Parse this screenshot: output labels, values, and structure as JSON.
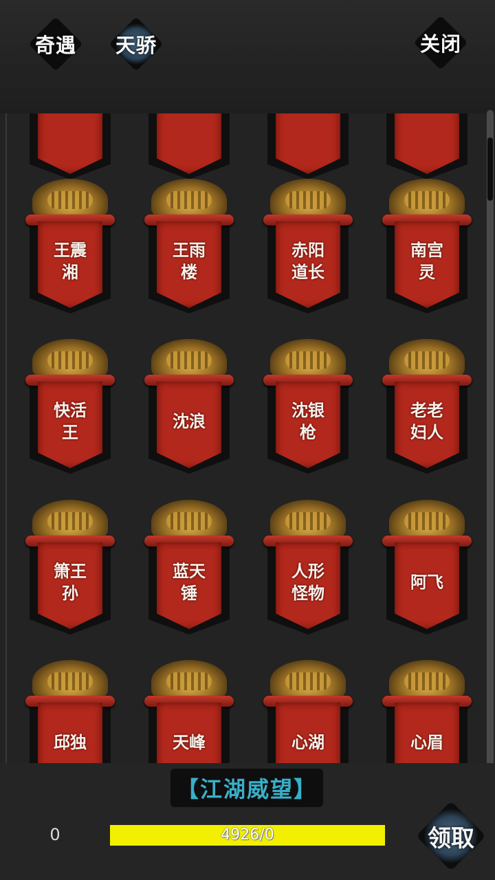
{
  "tabs": [
    {
      "label": "奇遇",
      "active": false
    },
    {
      "label": "天骄",
      "active": true
    }
  ],
  "close_label": "关闭",
  "banners": [
    {
      "name": ""
    },
    {
      "name": ""
    },
    {
      "name": ""
    },
    {
      "name": ""
    },
    {
      "name": "王震湘"
    },
    {
      "name": "王雨楼"
    },
    {
      "name": "赤阳道长"
    },
    {
      "name": "南宫灵"
    },
    {
      "name": "快活王"
    },
    {
      "name": "沈浪"
    },
    {
      "name": "沈银枪"
    },
    {
      "name": "老老妇人"
    },
    {
      "name": "箫王孙"
    },
    {
      "name": "蓝天锤"
    },
    {
      "name": "人形怪物"
    },
    {
      "name": "阿飞"
    },
    {
      "name": "邱独"
    },
    {
      "name": "天峰"
    },
    {
      "name": "心湖"
    },
    {
      "name": "心眉"
    }
  ],
  "footer": {
    "title": "【江湖威望】",
    "count": "0",
    "progress_text": "4926/0",
    "progress_fraction": 1.0,
    "claim_label": "领取"
  },
  "colors": {
    "banner_red": "#b3281c",
    "title_cyan": "#39b0c9",
    "progress_yellow": "#f2f000"
  }
}
